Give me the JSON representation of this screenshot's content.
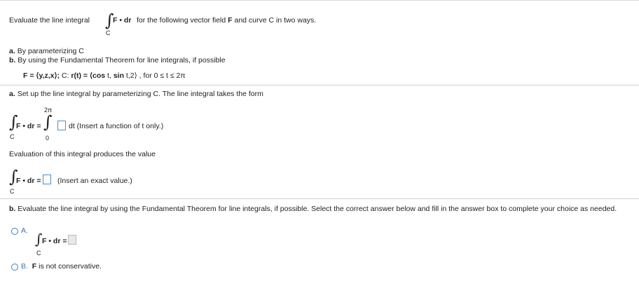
{
  "intro": {
    "prefix": "Evaluate the line integral",
    "integrand": "F • dr",
    "suffix_a": "for the following vector field",
    "bold_F": "F",
    "suffix_b": "and curve C in two ways.",
    "subscript": "C"
  },
  "parts": {
    "a_label": "a.",
    "a_text": "By parameterizing C",
    "b_label": "b.",
    "b_text": "By using the Fundamental Theorem for line integrals, if possible"
  },
  "field": {
    "F_eq": "F = ⟨y,z,x⟩;",
    "C_label": "C:",
    "r_label": "r(t) = ⟨",
    "r_cos": "cos",
    "r_t1": " t,",
    "r_sin": "sin",
    "r_t2": " t,2⟩ , for 0 ≤ t ≤ 2π"
  },
  "section_a": {
    "label": "a.",
    "text": "Set up the line integral by parameterizing C. The line integral takes the form",
    "upper": "2π",
    "lower": "0",
    "integrand": "F • dr =",
    "subscript": "C",
    "dt_hint": "dt  (Insert a function of t only.)",
    "eval_text": "Evaluation of this integral produces the value",
    "value_integrand": "F • dr =",
    "value_hint": "(Insert an exact value.)"
  },
  "section_b": {
    "label": "b.",
    "text": "Evaluate the line integral by using the Fundamental Theorem for line integrals, if possible. Select the correct answer below and fill in the answer box to complete your choice as needed.",
    "option_a_letter": "A.",
    "option_a_integrand": "F • dr =",
    "option_a_subscript": "C",
    "option_b_letter": "B.",
    "option_b_bold": "F",
    "option_b_text": "is not conservative."
  }
}
